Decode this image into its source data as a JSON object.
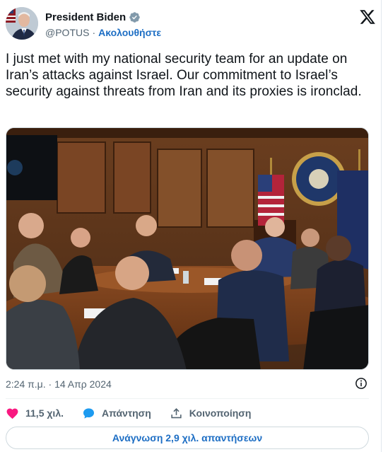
{
  "author": {
    "display_name": "President Biden",
    "handle": "@POTUS",
    "separator": "·",
    "follow_label": "Ακολουθήστε"
  },
  "tweet": {
    "text": "I just met with my national security team for an update on Iran’s attacks against Israel. Our commitment to Israel’s security against threats from Iran and its proxies is ironclad."
  },
  "meta": {
    "timestamp": "2:24 π.μ. · 14 Απρ 2024"
  },
  "actions": {
    "likes_count": "11,5 χιλ.",
    "reply_label": "Απάντηση",
    "share_label": "Κοινοποίηση"
  },
  "read_replies_label": "Ανάγνωση 2,9 χιλ. απαντήσεων",
  "icons": {
    "like": "heart-icon",
    "reply": "speech-bubble-icon",
    "share": "share-icon",
    "info": "info-icon",
    "brand": "x-logo-icon",
    "verified": "verified-badge-icon"
  },
  "colors": {
    "link": "#1d6ec4",
    "like": "#f91880",
    "reply": "#1d9bf0",
    "muted": "#536471",
    "text": "#0f1419",
    "verified": "#829aab"
  }
}
